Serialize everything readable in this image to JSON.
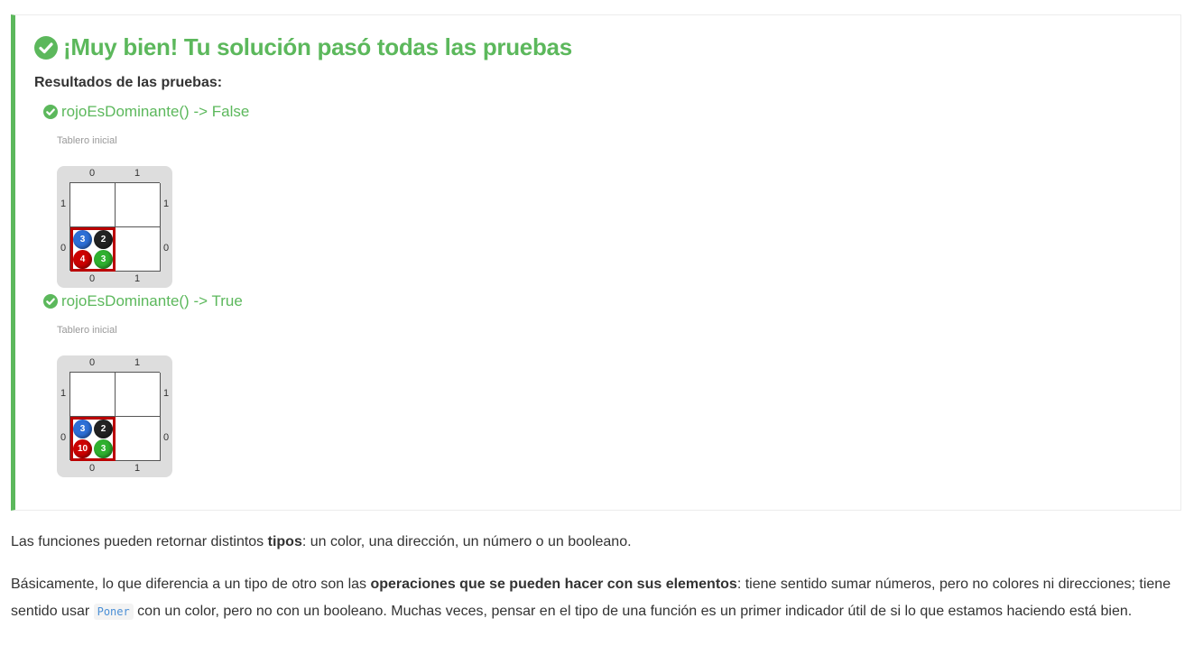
{
  "result": {
    "title": "¡Muy bien! Tu solución pasó todas las pruebas",
    "results_label": "Resultados de las pruebas:",
    "colors": {
      "success": "#5cb85c",
      "head": "#bb0000"
    },
    "tests": [
      {
        "label": "rojoEsDominante() -> False",
        "caption": "Tablero inicial",
        "board": {
          "x_labels": [
            "0",
            "1"
          ],
          "y_labels": [
            "1",
            "0"
          ],
          "cell": {
            "azul": "3",
            "negro": "2",
            "rojo": "4",
            "verde": "3"
          }
        }
      },
      {
        "label": "rojoEsDominante() -> True",
        "caption": "Tablero inicial",
        "board": {
          "x_labels": [
            "0",
            "1"
          ],
          "y_labels": [
            "1",
            "0"
          ],
          "cell": {
            "azul": "3",
            "negro": "2",
            "rojo": "10",
            "verde": "3"
          }
        }
      }
    ]
  },
  "paragraphs": {
    "p1": {
      "before": "Las funciones pueden retornar distintos ",
      "bold": "tipos",
      "after": ": un color, una dirección, un número o un booleano."
    },
    "p2": {
      "before": "Básicamente, lo que diferencia a un tipo de otro son las ",
      "bold": "operaciones que se pueden hacer con sus elementos",
      "middle": ": tiene sentido sumar números, pero no colores ni direcciones; tiene sentido usar ",
      "code": "Poner",
      "after": " con un color, pero no con un booleano. Muchas veces, pensar en el tipo de una función es un primer indicador útil de si lo que estamos haciendo está bien."
    }
  }
}
